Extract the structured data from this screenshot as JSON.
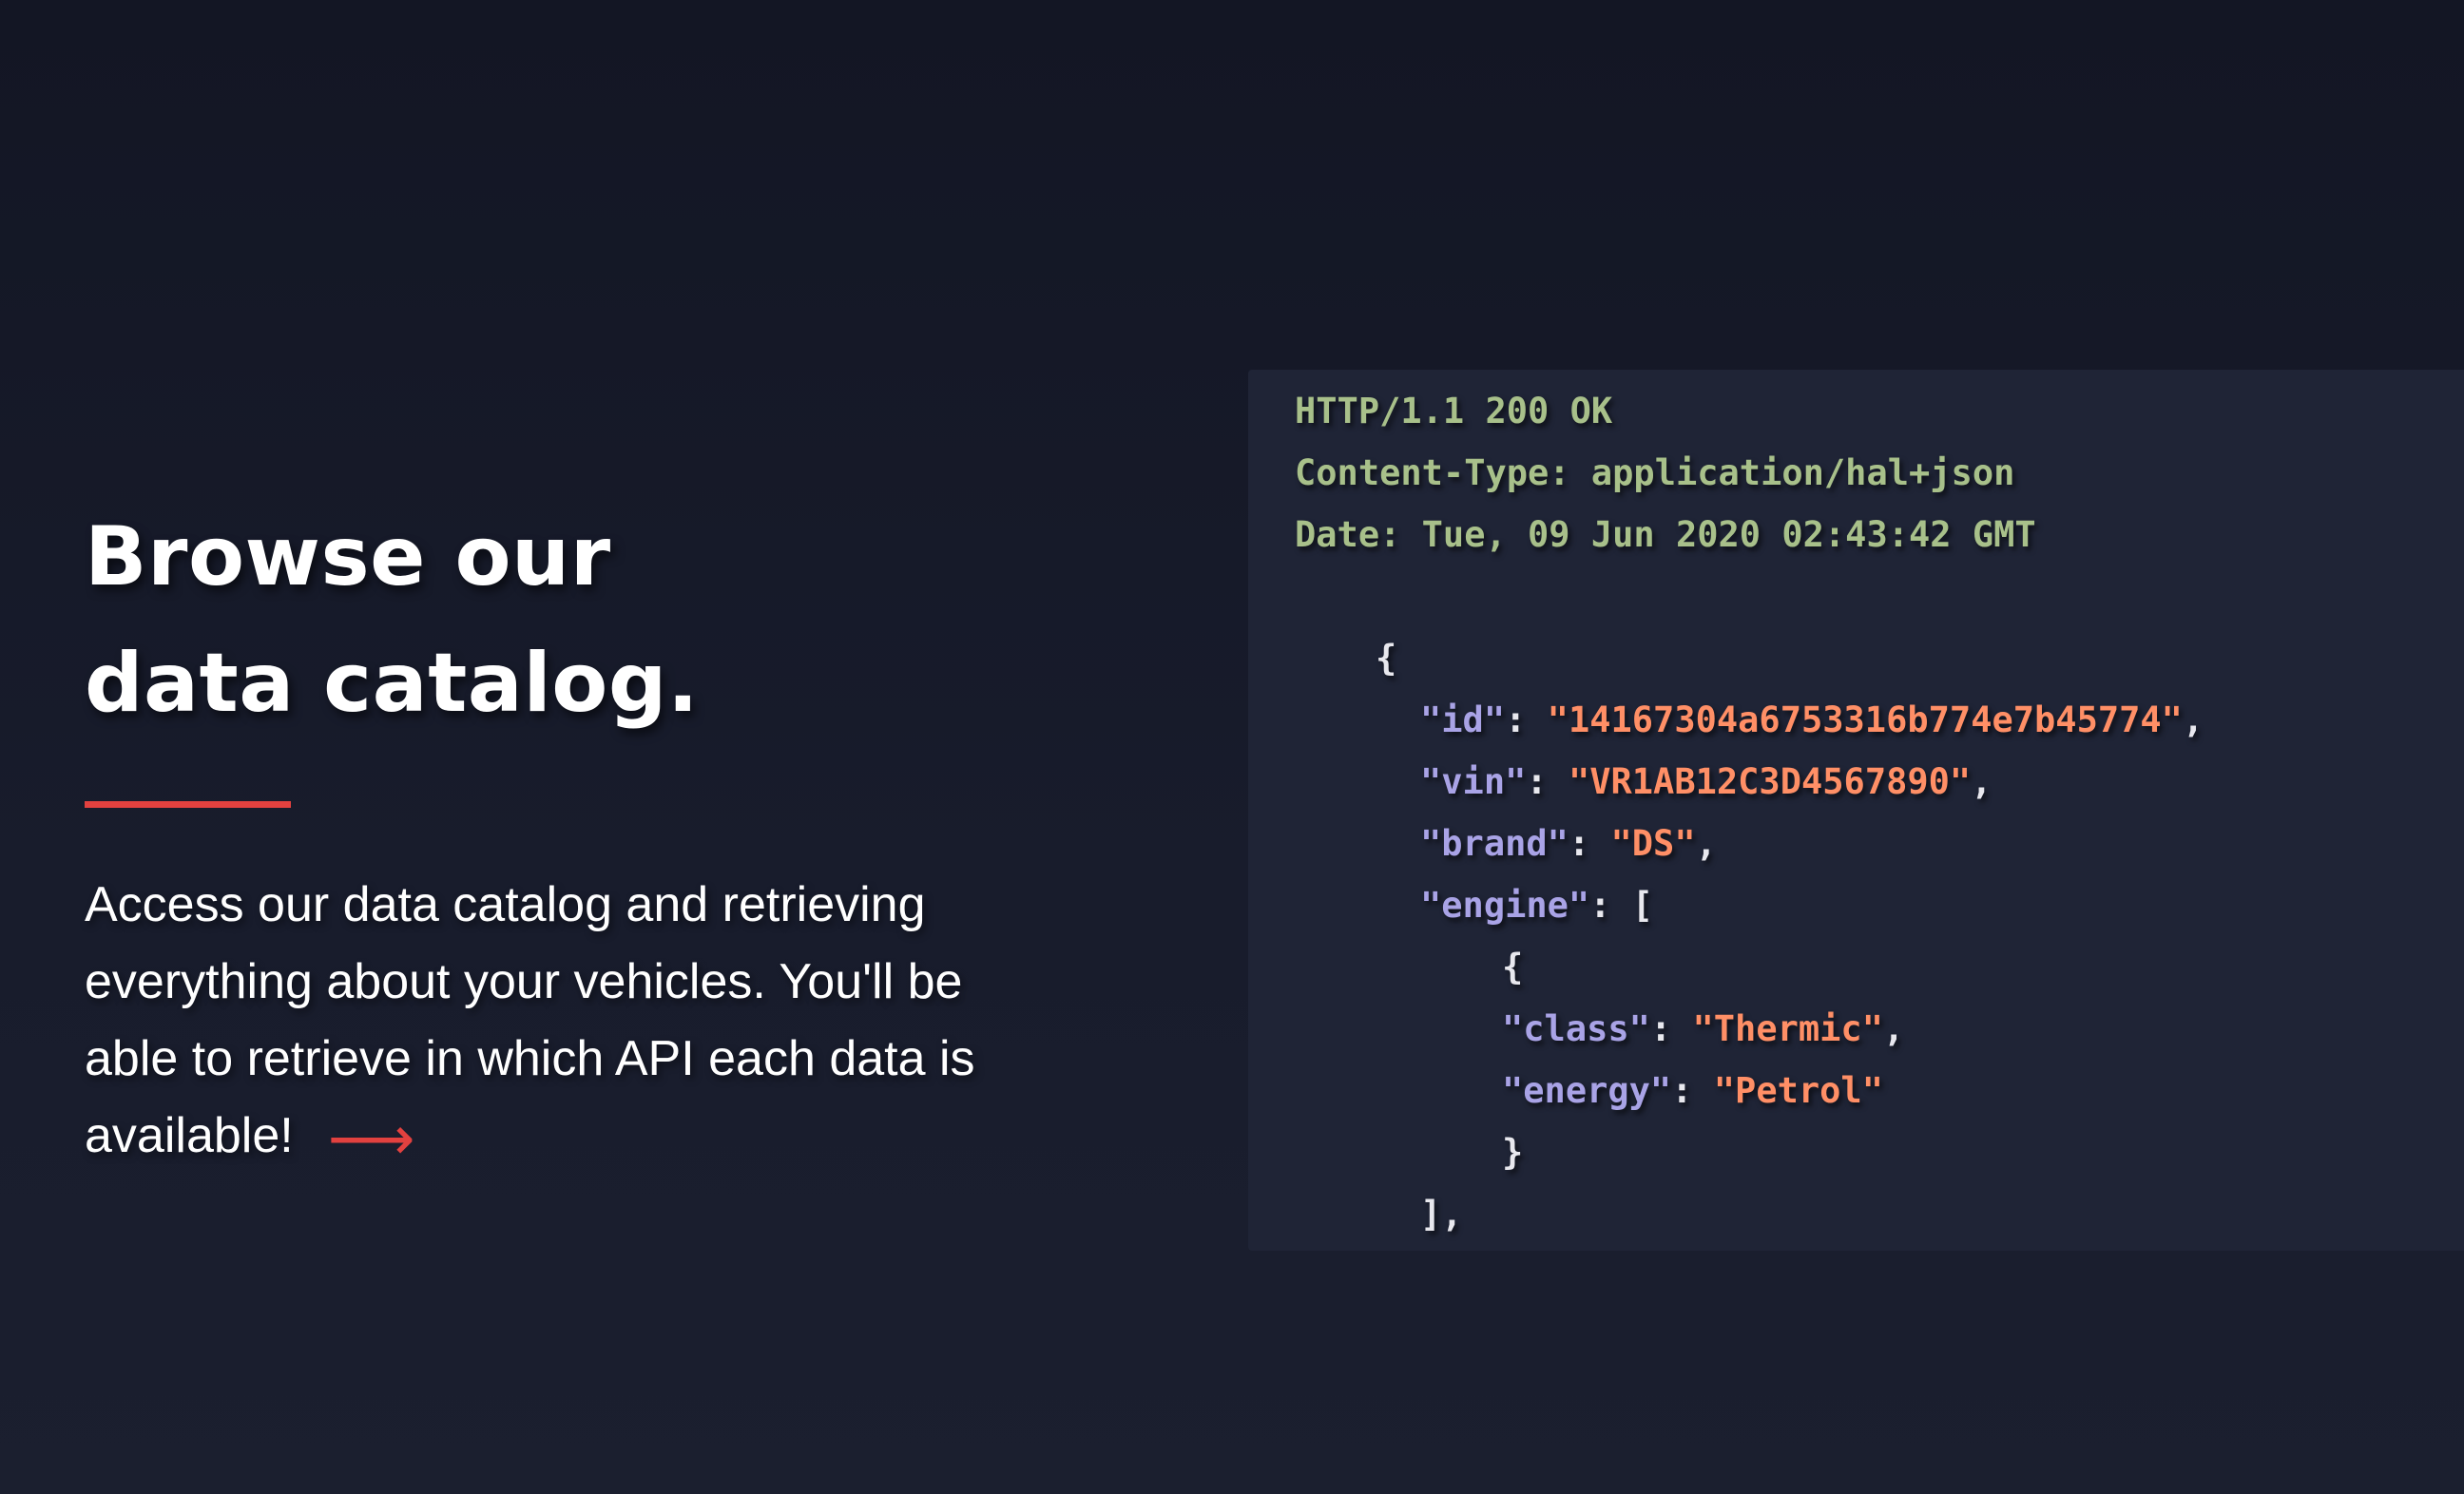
{
  "hero": {
    "title_line1": "Browse our",
    "title_line2": "data catalog.",
    "description": "Access our data catalog and retrieving everything about your vehicles. You'll be able to retrieve in which API each data is available!",
    "arrow": "⟶"
  },
  "code": {
    "status_line": "HTTP/1.1 200 OK",
    "content_type": "Content-Type: application/hal+json",
    "date": "Date: Tue, 09 Jun 2020 02:43:42 GMT",
    "open_brace": "{",
    "id_key": "\"id\"",
    "id_value": "\"14167304a6753316b774e7b45774\"",
    "vin_key": "\"vin\"",
    "vin_value": "\"VR1AB12C3D4567890\"",
    "brand_key": "\"brand\"",
    "brand_value": "\"DS\"",
    "engine_key": "\"engine\"",
    "engine_open": "[",
    "engine_item_open": "{",
    "class_key": "\"class\"",
    "class_value": "\"Thermic\"",
    "energy_key": "\"energy\"",
    "energy_value": "\"Petrol\"",
    "engine_item_close": "}",
    "engine_close": "],"
  },
  "colors": {
    "background": "#161a2a",
    "panel": "#1f2436",
    "accent": "#e2413f",
    "header_text": "#a8c08a",
    "json_key": "#a9a3e6",
    "json_string": "#ff8f66"
  }
}
